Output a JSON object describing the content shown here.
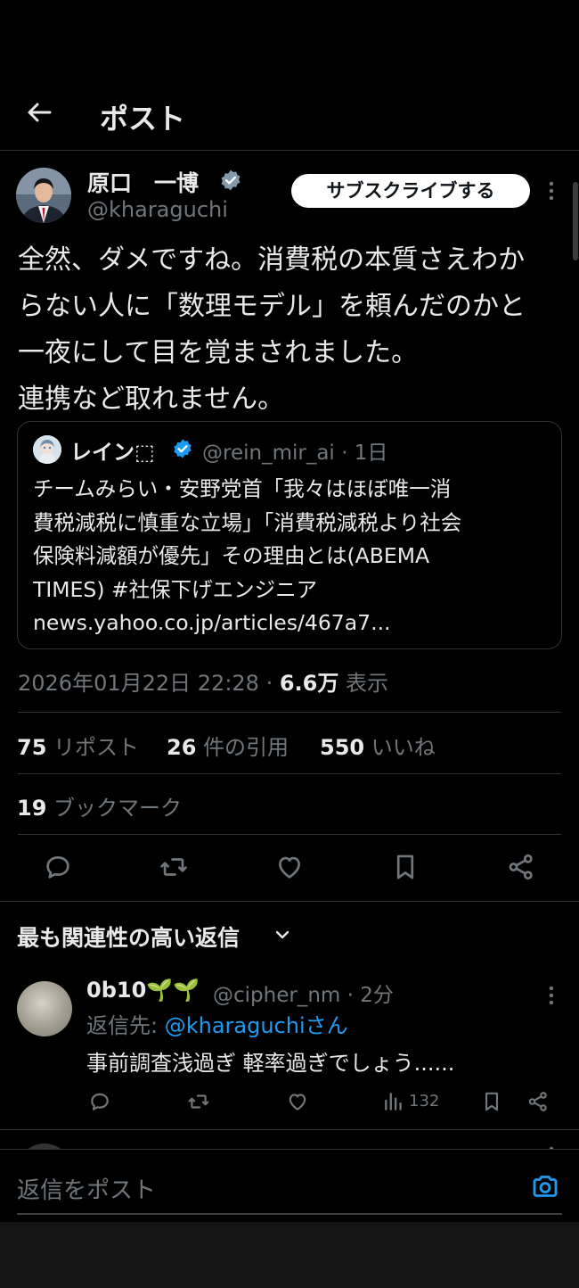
{
  "header": {
    "title": "ポスト"
  },
  "author": {
    "name": "原口　一博",
    "handle": "@kharaguchi",
    "subscribe_label": "サブスクライブする"
  },
  "tweet": {
    "text": "全然、ダメですね。消費税の本質さえわか\nらない人に「数理モデル」を頼んだのかと\n一夜にして目を覚まされました。\n連携など取れません。"
  },
  "quote": {
    "name": "レイン⬚",
    "handle": "@rein_mir_ai · 1日",
    "lines": [
      "チームみらい・安野党首「我々はほぼ唯一消",
      "費税減税に慎重な立場」「消費税減税より社会",
      "保険料減額が優先」その理由とは(ABEMA",
      "TIMES) #社保下げエンジニア",
      "news.yahoo.co.jp/articles/467a7..."
    ]
  },
  "meta": {
    "timestamp": "2026年01月22日 22:28 · ",
    "views_count": "6.6万",
    "views_label": " 表示"
  },
  "stats": {
    "reposts_count": "75",
    "reposts_label": " リポスト",
    "quotes_count": "26",
    "quotes_label": " 件の引用",
    "likes_count": "550",
    "likes_label": " いいね",
    "bookmarks_count": "19",
    "bookmarks_label": " ブックマーク"
  },
  "replies": {
    "section_title": "最も関連性の高い返信",
    "items": [
      {
        "name": "0b10🌱🌱",
        "handle": "@cipher_nm · 2分",
        "reply_to_label": "返信先: ",
        "reply_to_handle": "@kharaguchiさん",
        "text": "事前調査浅過ぎ 軽率過ぎでしょう......",
        "views": "132"
      }
    ]
  },
  "compose": {
    "placeholder": "返信をポスト"
  },
  "colors": {
    "accent": "#1d9bf0",
    "background": "#000000",
    "text": "#e7e9ea",
    "muted": "#71767b",
    "divider": "#2f3336"
  }
}
